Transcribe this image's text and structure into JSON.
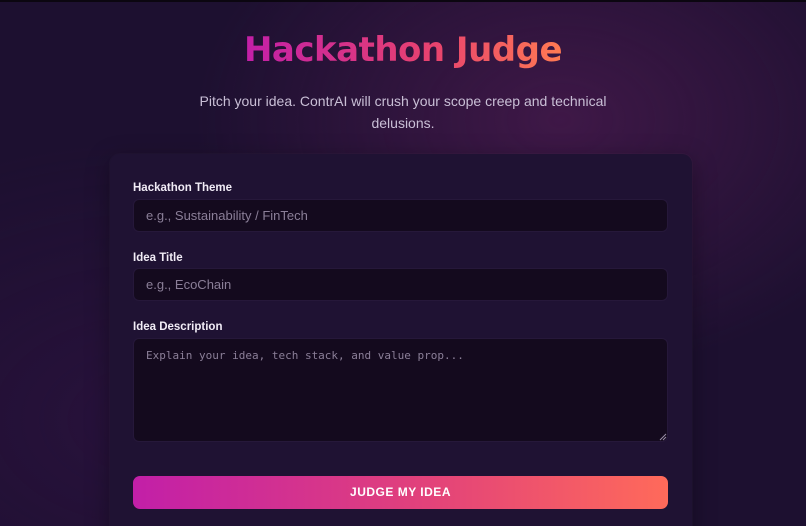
{
  "header": {
    "title": "Hackathon Judge",
    "subtitle": "Pitch your idea. ContrAI will crush your scope creep and technical delusions."
  },
  "form": {
    "theme": {
      "label": "Hackathon Theme",
      "value": "",
      "placeholder": "e.g., Sustainability / FinTech"
    },
    "title": {
      "label": "Idea Title",
      "value": "",
      "placeholder": "e.g., EcoChain"
    },
    "description": {
      "label": "Idea Description",
      "value": "",
      "placeholder": "Explain your idea, tech stack, and value prop..."
    },
    "submit_label": "JUDGE MY IDEA"
  },
  "colors": {
    "background": "#1d1030",
    "card": "#1f1233",
    "input": "#140a1e",
    "accent_start": "#c21fa8",
    "accent_end": "#ff6a5a"
  },
  "icons": {
    "resize": "textarea-resize-icon"
  }
}
